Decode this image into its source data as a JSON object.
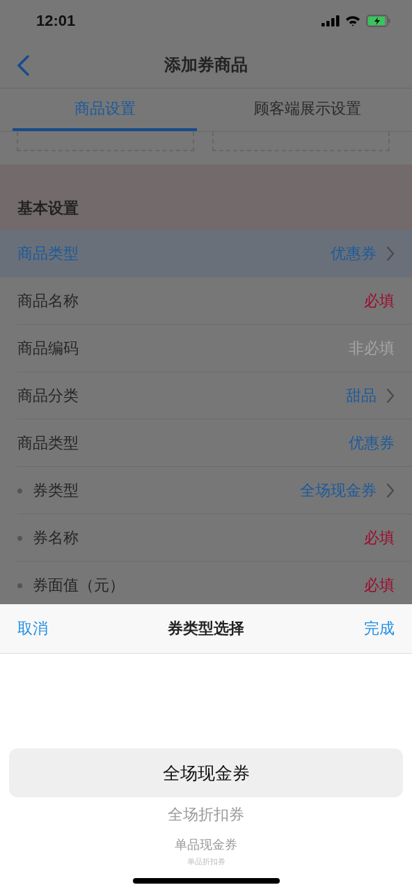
{
  "status_bar": {
    "time": "12:01"
  },
  "nav": {
    "title": "添加券商品"
  },
  "tabs": [
    {
      "label": "商品设置",
      "selected": true
    },
    {
      "label": "顾客端展示设置",
      "selected": false
    }
  ],
  "section": {
    "title": "基本设置"
  },
  "rows": [
    {
      "label": "商品类型",
      "value": "优惠券",
      "kind": "select",
      "bullet": false,
      "selected": true
    },
    {
      "label": "商品名称",
      "value": "必填",
      "kind": "required",
      "bullet": false,
      "selected": false
    },
    {
      "label": "商品编码",
      "value": "非必填",
      "kind": "optional",
      "bullet": false,
      "selected": false
    },
    {
      "label": "商品分类",
      "value": "甜品",
      "kind": "select",
      "bullet": false,
      "selected": false
    },
    {
      "label": "商品类型",
      "value": "优惠券",
      "kind": "value",
      "bullet": false,
      "selected": false
    },
    {
      "label": "券类型",
      "value": "全场现金券",
      "kind": "select",
      "bullet": true,
      "selected": false
    },
    {
      "label": "券名称",
      "value": "必填",
      "kind": "required",
      "bullet": true,
      "selected": false
    },
    {
      "label": "券面值（元）",
      "value": "必填",
      "kind": "required",
      "bullet": true,
      "selected": false
    }
  ],
  "picker": {
    "cancel": "取消",
    "title": "券类型选择",
    "done": "完成",
    "options": [
      {
        "label": "全场现金券",
        "selected": true
      },
      {
        "label": "全场折扣券",
        "selected": false
      },
      {
        "label": "单品现金券",
        "selected": false
      },
      {
        "label": "单品折扣券",
        "selected": false
      }
    ]
  }
}
